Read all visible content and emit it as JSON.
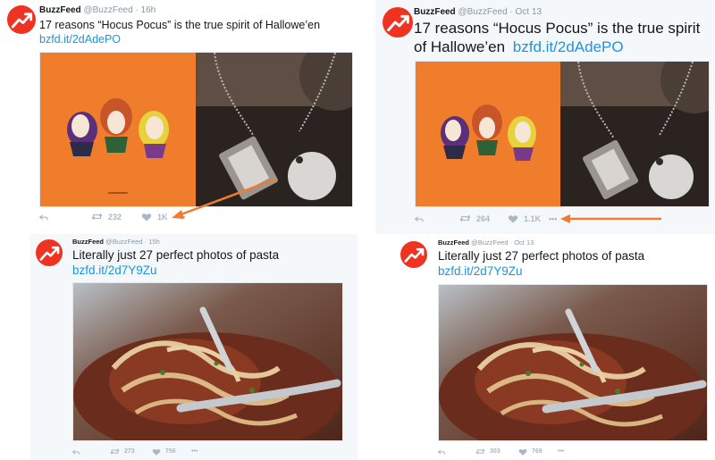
{
  "tweets": [
    {
      "name": "BuzzFeed",
      "handle": "@BuzzFeed",
      "separator": "·",
      "time": "16h",
      "text_lines": [
        "17 reasons “Hocus Pocus” is the true spirit of Hallowe’en"
      ],
      "link": "bzfd.it/2dAdePO",
      "retweets": "232",
      "likes": "1K",
      "more": "•••"
    },
    {
      "name": "BuzzFeed",
      "handle": "@BuzzFeed",
      "separator": "·",
      "time": "Oct 13",
      "text_lines": [
        "17 reasons “Hocus Pocus” is the true spirit",
        "of Hallowe’en"
      ],
      "link": "bzfd.it/2dAdePO",
      "retweets": "264",
      "likes": "1.1K",
      "more": "•••"
    },
    {
      "name": "BuzzFeed",
      "handle": "@BuzzFeed",
      "separator": "·",
      "time": "15h",
      "text_lines": [
        "Literally just 27 perfect photos of pasta"
      ],
      "link": "bzfd.it/2d7Y9Zu",
      "retweets": "273",
      "likes": "756",
      "more": "•••"
    },
    {
      "name": "BuzzFeed",
      "handle": "@BuzzFeed",
      "separator": "·",
      "time": "Oct 13",
      "text_lines": [
        "Literally just 27 perfect photos of pasta"
      ],
      "link": "bzfd.it/2d7Y9Zu",
      "retweets": "303",
      "likes": "769",
      "more": "•••"
    }
  ],
  "colors": {
    "brand": "#ee3322",
    "link": "#1b95e0",
    "annotation_arrow": "#f07b30",
    "action_gray": "#aab8c2"
  },
  "icons": [
    "buzzfeed-logo-icon",
    "reply-icon",
    "retweet-icon",
    "like-icon",
    "more-icon"
  ]
}
